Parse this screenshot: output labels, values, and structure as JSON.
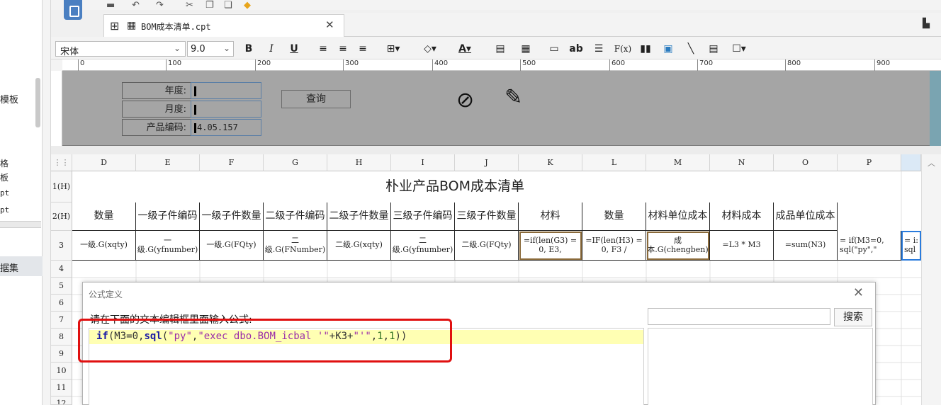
{
  "left_panel": {
    "items": [
      "模板",
      "格",
      "板",
      "pt",
      "pt",
      "据集"
    ]
  },
  "tab": {
    "label": "BOM成本清单.cpt"
  },
  "format_bar": {
    "font": "宋体",
    "size": "9.0",
    "bold": "B",
    "italic": "I",
    "underline": "U",
    "text_ab": "ab",
    "fx": "F(x)"
  },
  "ruler_ticks": [
    "0",
    "100",
    "200",
    "300",
    "400",
    "500",
    "600",
    "700",
    "800",
    "900"
  ],
  "params": {
    "year_label": "年度:",
    "month_label": "月度:",
    "code_label": "产品编码:",
    "code_value": "4.05.157",
    "query_button": "查询"
  },
  "columns": [
    "D",
    "E",
    "F",
    "G",
    "H",
    "I",
    "J",
    "K",
    "L",
    "M",
    "N",
    "O",
    "P"
  ],
  "rows": [
    "1(H)",
    "2(H)",
    "3",
    "4",
    "5",
    "6",
    "7",
    "8",
    "9",
    "10",
    "11",
    "12"
  ],
  "title": "朴业产品BOM成本清单",
  "headers": [
    "数量",
    "一级子件编码",
    "一级子件数量",
    "二级子件编码",
    "二级子件数量",
    "三级子件编码",
    "三级子件数量",
    "材料",
    "数量",
    "材料单位成本",
    "材料成本",
    "成品单位成本",
    ""
  ],
  "row3": [
    "一级.G(xqty)",
    "一级.G(yfnumber)",
    "一级.G(FQty)",
    "二级.G(FNumber)",
    "二级.G(xqty)",
    "二级.G(yfnumber)",
    "二级.G(FQty)",
    "=if(len(G3) = 0, E3,",
    "=IF(len(H3) = 0, F3 /",
    "成本.G(chengben)",
    "=L3 * M3",
    "=sum(N3)",
    "= if(M3=0, sql(\"py\",\""
  ],
  "row3_q": "= i: sql",
  "dialog": {
    "title": "公式定义",
    "prompt": "请在下面的文本编辑框里面输入公式:",
    "formula_parts": [
      "if",
      "(M3=0,",
      "sql",
      "(",
      "\"py\"",
      ",",
      "\"exec dbo.BOM_icbal '\"",
      "+K3+",
      "\"'\"",
      ",",
      "1",
      ",",
      "1",
      "))"
    ],
    "search_button": "搜索",
    "search_value": ""
  },
  "colors": {
    "highlight_box": "#e01010",
    "param_bg": "#a5a5a5",
    "editor_line": "#ffffb3"
  }
}
